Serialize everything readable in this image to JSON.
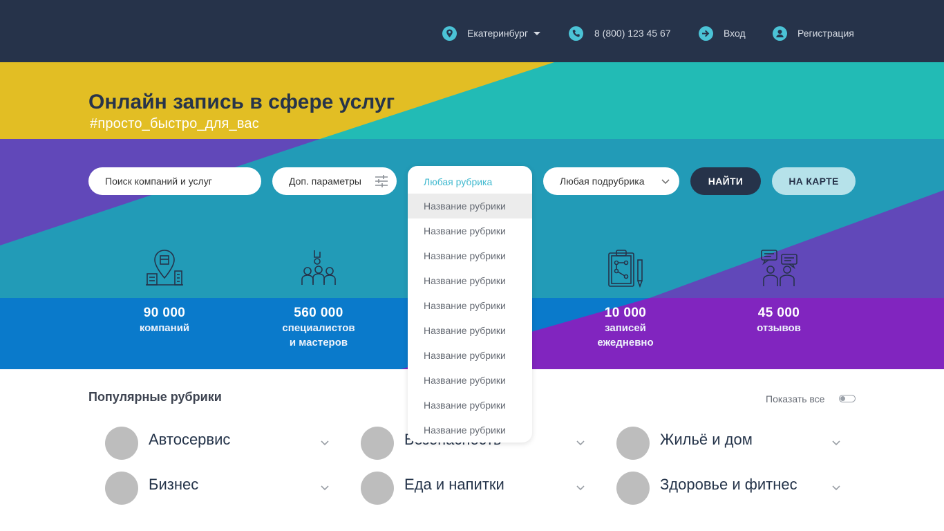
{
  "header": {
    "city": "Екатеринбург",
    "phone": "8 (800) 123 45 67",
    "login": "Вход",
    "register": "Регистрация",
    "icons": {
      "city": "location-pin-icon",
      "phone": "phone-icon",
      "login": "login-arrow-icon",
      "register": "user-icon"
    },
    "accent": "#4bc3d6"
  },
  "hero": {
    "title": "Онлайн запись в сфере услуг",
    "subtitle": "#просто_быстро_для_вас",
    "colors": {
      "yellow": "#e2be24",
      "teal": "#22bbb5",
      "purple": "#6148b9",
      "blue": "#229bb7",
      "darkblue": "#0a7acb",
      "violet": "#8125bf"
    }
  },
  "search": {
    "placeholder": "Поиск компаний и услуг",
    "params_label": "Доп. параметры",
    "category_label": "Любая рубрика",
    "subcategory_label": "Любая подрубрика",
    "find_button": "НАЙТИ",
    "map_button": "НА КАРТЕ"
  },
  "dropdown": {
    "header": "Любая рубрика",
    "items": [
      "Название рубрики",
      "Название рубрики",
      "Название рубрики",
      "Название рубрики",
      "Название рубрики",
      "Название рубрики",
      "Название рубрики",
      "Название рубрики",
      "Название рубрики",
      "Название рубрики"
    ]
  },
  "stats": [
    {
      "number": "90 000",
      "label1": "компаний",
      "label2": "",
      "icon": "map-pin-building-icon"
    },
    {
      "number": "560 000",
      "label1": "специалистов",
      "label2": "и мастеров",
      "icon": "specialists-group-icon"
    },
    {
      "number": "10 000",
      "label1": "записей",
      "label2": "ежедневно",
      "icon": "clipboard-plan-icon"
    },
    {
      "number": "45 000",
      "label1": "отзывов",
      "label2": "",
      "icon": "reviews-chat-icon"
    }
  ],
  "popular": {
    "title": "Популярные рубрики",
    "show_all": "Показать все",
    "show_all_on": false,
    "categories": [
      {
        "label": "Автосервис"
      },
      {
        "label": "Безопасность"
      },
      {
        "label": "Жильё и дом"
      },
      {
        "label": "Бизнес"
      },
      {
        "label": "Еда и напитки"
      },
      {
        "label": "Здоровье и фитнес"
      }
    ]
  }
}
